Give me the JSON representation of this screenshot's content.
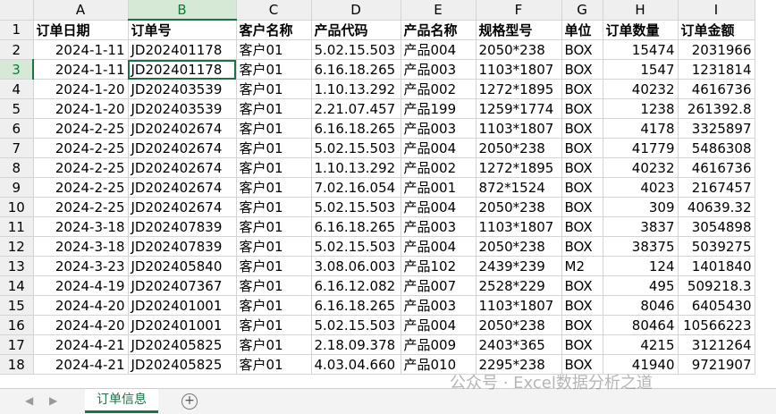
{
  "spreadsheet": {
    "columns": [
      "A",
      "B",
      "C",
      "D",
      "E",
      "F",
      "G",
      "H",
      "I"
    ],
    "selected_column": "B",
    "selected_row": 3,
    "rows": [
      {
        "n": 1,
        "cells": [
          "订单日期",
          "订单号",
          "客户名称",
          "产品代码",
          "产品名称",
          "规格型号",
          "单位",
          "订单数量",
          "订单金额"
        ]
      },
      {
        "n": 2,
        "cells": [
          "2024-1-11",
          "JD202401178",
          "客户01",
          "5.02.15.503",
          "产品004",
          "2050*238",
          "BOX",
          "15474",
          "2031966"
        ]
      },
      {
        "n": 3,
        "cells": [
          "2024-1-11",
          "JD202401178",
          "客户01",
          "6.16.18.265",
          "产品003",
          "1103*1807",
          "BOX",
          "1547",
          "1231814"
        ]
      },
      {
        "n": 4,
        "cells": [
          "2024-1-20",
          "JD202403539",
          "客户01",
          "1.10.13.292",
          "产品002",
          "1272*1895",
          "BOX",
          "40232",
          "4616736"
        ]
      },
      {
        "n": 5,
        "cells": [
          "2024-1-20",
          "JD202403539",
          "客户01",
          "2.21.07.457",
          "产品199",
          "1259*1774",
          "BOX",
          "1238",
          "261392.8"
        ]
      },
      {
        "n": 6,
        "cells": [
          "2024-2-25",
          "JD202402674",
          "客户01",
          "6.16.18.265",
          "产品003",
          "1103*1807",
          "BOX",
          "4178",
          "3325897"
        ]
      },
      {
        "n": 7,
        "cells": [
          "2024-2-25",
          "JD202402674",
          "客户01",
          "5.02.15.503",
          "产品004",
          "2050*238",
          "BOX",
          "41779",
          "5486308"
        ]
      },
      {
        "n": 8,
        "cells": [
          "2024-2-25",
          "JD202402674",
          "客户01",
          "1.10.13.292",
          "产品002",
          "1272*1895",
          "BOX",
          "40232",
          "4616736"
        ]
      },
      {
        "n": 9,
        "cells": [
          "2024-2-25",
          "JD202402674",
          "客户01",
          "7.02.16.054",
          "产品001",
          "872*1524",
          "BOX",
          "4023",
          "2167457"
        ]
      },
      {
        "n": 10,
        "cells": [
          "2024-2-25",
          "JD202402674",
          "客户01",
          "5.02.15.503",
          "产品004",
          "2050*238",
          "BOX",
          "309",
          "40639.32"
        ]
      },
      {
        "n": 11,
        "cells": [
          "2024-3-18",
          "JD202407839",
          "客户01",
          "6.16.18.265",
          "产品003",
          "1103*1807",
          "BOX",
          "3837",
          "3054898"
        ]
      },
      {
        "n": 12,
        "cells": [
          "2024-3-18",
          "JD202407839",
          "客户01",
          "5.02.15.503",
          "产品004",
          "2050*238",
          "BOX",
          "38375",
          "5039275"
        ]
      },
      {
        "n": 13,
        "cells": [
          "2024-3-23",
          "JD202405840",
          "客户01",
          "3.08.06.003",
          "产品102",
          "2439*239",
          "M2",
          "124",
          "1401840"
        ]
      },
      {
        "n": 14,
        "cells": [
          "2024-4-19",
          "JD202407367",
          "客户01",
          "6.16.12.082",
          "产品007",
          "2528*229",
          "BOX",
          "495",
          "509218.3"
        ]
      },
      {
        "n": 15,
        "cells": [
          "2024-4-20",
          "JD202401001",
          "客户01",
          "6.16.18.265",
          "产品003",
          "1103*1807",
          "BOX",
          "8046",
          "6405430"
        ]
      },
      {
        "n": 16,
        "cells": [
          "2024-4-20",
          "JD202401001",
          "客户01",
          "5.02.15.503",
          "产品004",
          "2050*238",
          "BOX",
          "80464",
          "10566223"
        ]
      },
      {
        "n": 17,
        "cells": [
          "2024-4-21",
          "JD202405825",
          "客户01",
          "2.18.09.378",
          "产品009",
          "2403*365",
          "BOX",
          "4215",
          "3121264"
        ]
      },
      {
        "n": 18,
        "cells": [
          "2024-4-21",
          "JD202405825",
          "客户01",
          "4.03.04.660",
          "产品010",
          "2295*238",
          "BOX",
          "41940",
          "9721907"
        ]
      }
    ]
  },
  "sheet_tabs": {
    "active": "订单信息",
    "prev_icon": "◀",
    "next_icon": "▶",
    "add_icon": "+"
  },
  "watermark": "公众号 · Excel数据分析之道"
}
